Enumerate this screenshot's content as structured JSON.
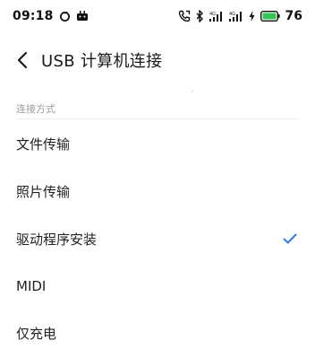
{
  "status_bar": {
    "time": "09:18",
    "left_icons": [
      "sync-icon",
      "android-icon"
    ],
    "right_icons": [
      "call-icon",
      "bluetooth-icon",
      "signal-1-icon",
      "signal-2-icon",
      "charging-icon",
      "battery-icon"
    ],
    "battery_level": "76",
    "battery_color": "#35c45a"
  },
  "header": {
    "title": "USB 计算机连接"
  },
  "section": {
    "header": "连接方式"
  },
  "options": [
    {
      "label": "文件传输",
      "selected": false
    },
    {
      "label": "照片传输",
      "selected": false
    },
    {
      "label": "驱动程序安装",
      "selected": true
    },
    {
      "label": "MIDI",
      "selected": false
    },
    {
      "label": "仅充电",
      "selected": false
    }
  ],
  "colors": {
    "accent": "#2f7de1",
    "text": "#1f1f1f",
    "subtle": "#9b9b9b"
  }
}
